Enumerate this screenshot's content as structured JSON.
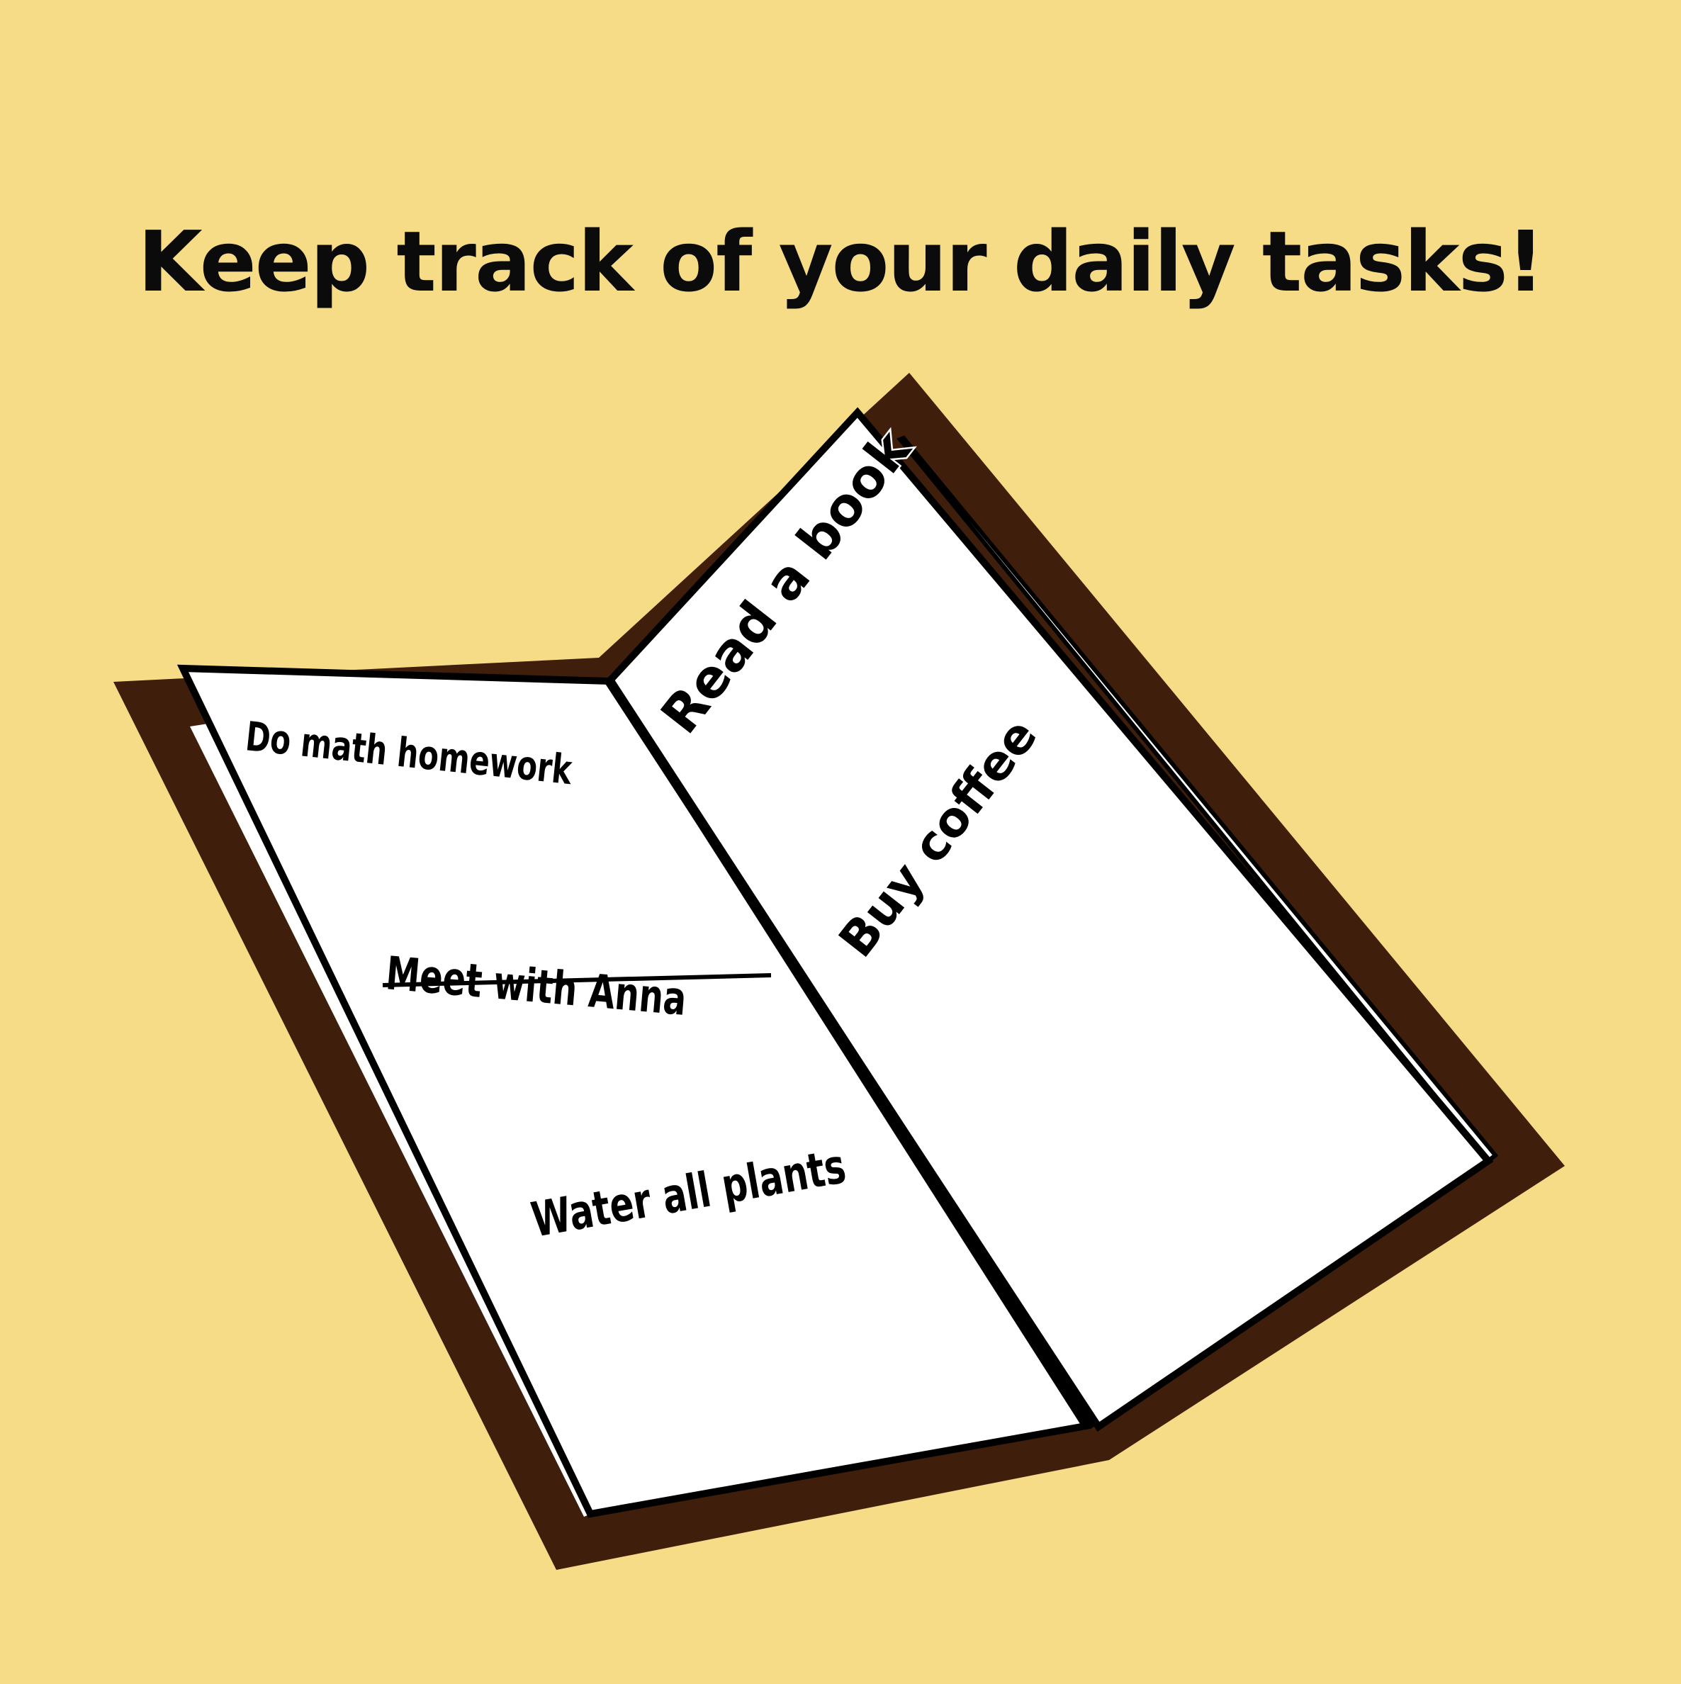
{
  "title": "Keep track of your daily tasks!",
  "colors": {
    "background": "#F6DC87",
    "cover": "#3F1F0C",
    "page": "#FFFFFF",
    "outline": "#000000"
  },
  "tasks": {
    "left_page": [
      {
        "label": "Do math homework",
        "done": false
      },
      {
        "label": "Meet with Anna",
        "done": true
      },
      {
        "label": "Water all plants",
        "done": false
      }
    ],
    "right_page": [
      {
        "label": "Read a book",
        "done": false
      },
      {
        "label": "Buy coffee",
        "done": false
      }
    ]
  }
}
